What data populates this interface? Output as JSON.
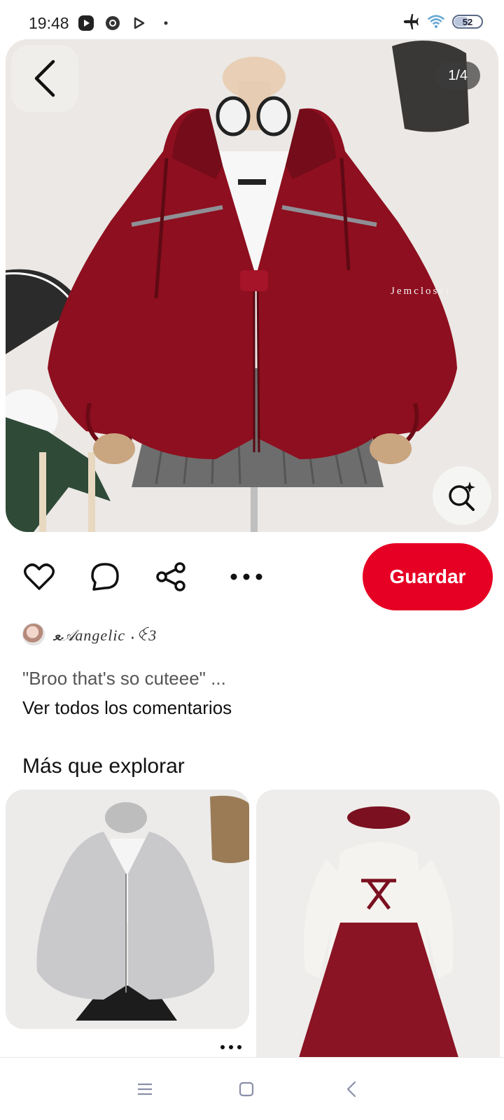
{
  "status_bar": {
    "time": "19:48",
    "left_icons": [
      "play-app-icon",
      "chrome-icon",
      "play-store-icon",
      "dot-icon"
    ],
    "airplane_icon": "airplane-icon",
    "wifi_icon": "wifi-icon",
    "battery_level": "52",
    "battery_fraction": 0.52
  },
  "pin": {
    "page_indicator": "1/4",
    "watermark": "Jemcloset",
    "back_icon": "back-chevron-icon",
    "lens_icon": "visual-search-icon"
  },
  "actions": {
    "like_icon": "heart-icon",
    "comment_icon": "comment-bubble-icon",
    "share_icon": "share-icon",
    "more_icon": "more-horizontal-icon",
    "save_label": "Guardar"
  },
  "comment": {
    "username": "ﻌ𝒜angelic ˖ꒊ3",
    "text": "\"Broo that's so cuteee\" ...",
    "view_all": "Ver todos los comentarios"
  },
  "explore": {
    "title": "Más que explorar"
  },
  "colors": {
    "brand_red": "#e60023",
    "jacket_red": "#8e0f1f"
  },
  "nav": {
    "menu_icon": "menu-icon",
    "home_icon": "home-square-icon",
    "back_icon": "back-icon"
  }
}
